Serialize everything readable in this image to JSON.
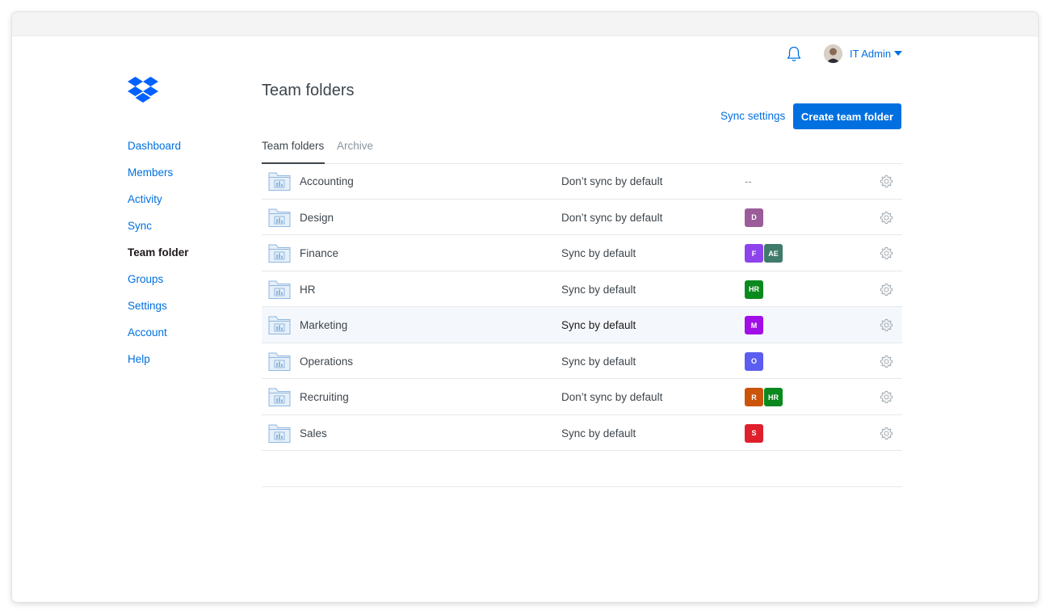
{
  "header": {
    "username": "IT Admin"
  },
  "sidebar": {
    "items": [
      {
        "label": "Dashboard"
      },
      {
        "label": "Members"
      },
      {
        "label": "Activity"
      },
      {
        "label": "Sync"
      },
      {
        "label": "Team folder",
        "active": true
      },
      {
        "label": "Groups"
      },
      {
        "label": "Settings"
      },
      {
        "label": "Account"
      },
      {
        "label": "Help"
      }
    ]
  },
  "main": {
    "title": "Team folders",
    "sync_settings_label": "Sync settings",
    "create_button_label": "Create team folder",
    "tabs": [
      {
        "label": "Team folders",
        "active": true
      },
      {
        "label": "Archive"
      }
    ]
  },
  "colors": {
    "accent": "#0070e0",
    "text": "#3d464d"
  },
  "folders": [
    {
      "name": "Accounting",
      "sync": "Don’t sync by default",
      "groups": [],
      "empty_label": "--"
    },
    {
      "name": "Design",
      "sync": "Don’t sync by default",
      "groups": [
        {
          "label": "D",
          "color": "#9b5c9a"
        }
      ]
    },
    {
      "name": "Finance",
      "sync": "Sync by default",
      "groups": [
        {
          "label": "F",
          "color": "#8e44ec"
        },
        {
          "label": "AE",
          "color": "#3f7a6a"
        }
      ]
    },
    {
      "name": "HR",
      "sync": "Sync by default",
      "groups": [
        {
          "label": "HR",
          "color": "#0a8a1e"
        }
      ]
    },
    {
      "name": "Marketing",
      "sync": "Sync by default",
      "groups": [
        {
          "label": "M",
          "color": "#a10ee8"
        }
      ],
      "highlighted": true
    },
    {
      "name": "Operations",
      "sync": "Sync by default",
      "groups": [
        {
          "label": "O",
          "color": "#5b5cf0"
        }
      ]
    },
    {
      "name": "Recruiting",
      "sync": "Don’t sync by default",
      "groups": [
        {
          "label": "R",
          "color": "#c9540a"
        },
        {
          "label": "HR",
          "color": "#0a8a1e"
        }
      ]
    },
    {
      "name": "Sales",
      "sync": "Sync by default",
      "groups": [
        {
          "label": "S",
          "color": "#e01f2c"
        }
      ]
    }
  ],
  "icons": {
    "bell": "bell-icon",
    "folder": "team-folder-icon",
    "gear": "gear-icon",
    "caret": "caret-down-icon",
    "logo": "dropbox-logo"
  }
}
